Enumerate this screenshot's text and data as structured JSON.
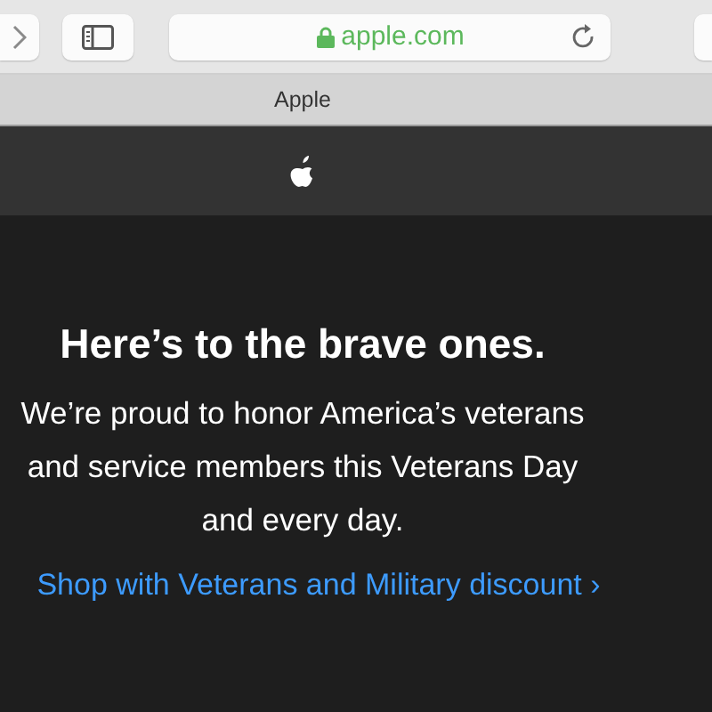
{
  "toolbar": {
    "address": "apple.com",
    "secure": true
  },
  "tab": {
    "title": "Apple"
  },
  "hero": {
    "headline": "Here’s to the brave ones.",
    "body": "We’re proud to honor America’s veterans and service members this Veterans Day and every day.",
    "link": "Shop with Veterans and Military discount ›"
  }
}
